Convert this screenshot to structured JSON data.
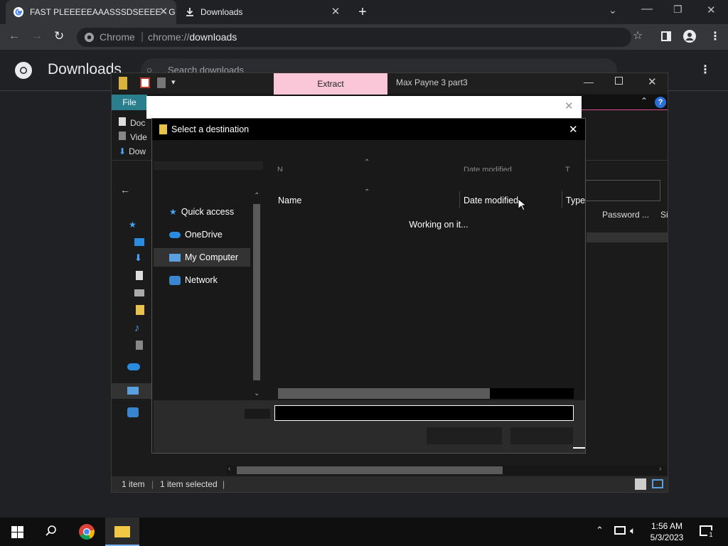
{
  "browser": {
    "tabs": [
      {
        "title": "FAST PLEEEEEAAASSSDSEEEE - G"
      },
      {
        "title": "Downloads"
      }
    ],
    "omnibox": {
      "site_label": "Chrome",
      "url_scheme": "chrome://",
      "url_host": "downloads"
    },
    "downloads": {
      "title": "Downloads",
      "search_placeholder": "Search downloads"
    }
  },
  "winrar": {
    "extract_tab": "Extract",
    "archive_title": "Max Payne 3 part3",
    "file_tab": "File",
    "sidebar_items": [
      "Doc",
      "Vide",
      "Dow"
    ],
    "column_password": "Password ...",
    "column_size": "Si",
    "status_items": "1 item",
    "status_selected": "1 item selected"
  },
  "dialog": {
    "title": "Select a destination",
    "nav_items": [
      "Quick access",
      "OneDrive",
      "My Computer",
      "Network"
    ],
    "columns": {
      "name": "Name",
      "date": "Date modified",
      "type": "Type"
    },
    "ghost_columns": {
      "name": "N",
      "date": "Date modified",
      "type": "T"
    },
    "working_text": "Working on it..."
  },
  "taskbar": {
    "time": "1:56 AM",
    "date": "5/3/2023",
    "notification_count": "1"
  },
  "colors": {
    "accent_pink": "#f9c7d8",
    "file_tab": "#2a7f8f",
    "chrome_blue": "#8ab4f8"
  }
}
